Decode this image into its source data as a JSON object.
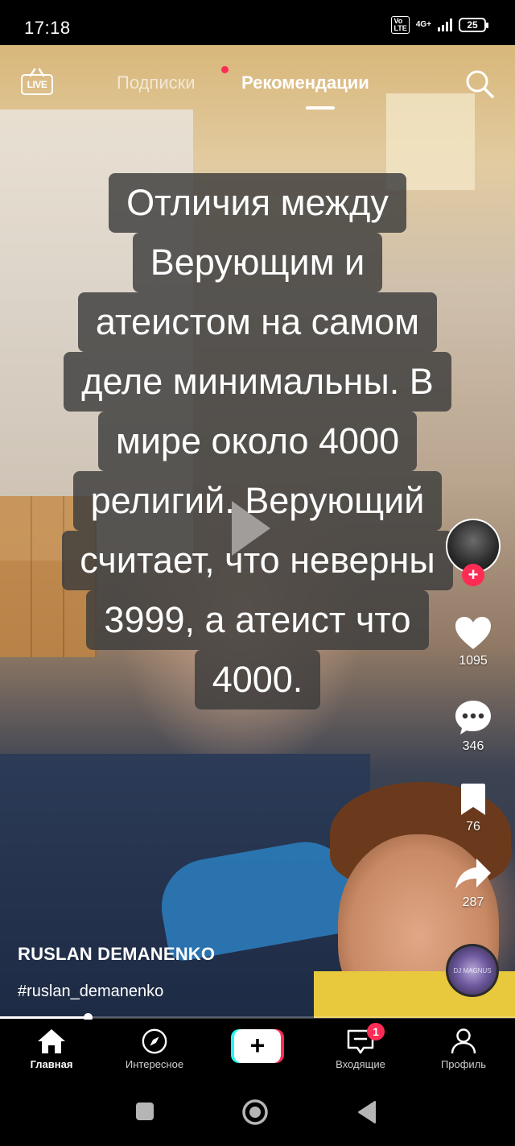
{
  "status_bar": {
    "time": "17:18",
    "volte_label": "Vo LTE",
    "network_label": "4G+",
    "battery_level": "25"
  },
  "top_nav": {
    "live_label": "LIVE",
    "tabs": [
      {
        "label": "Подписки",
        "active": false,
        "has_dot": true
      },
      {
        "label": "Рекомендации",
        "active": true
      }
    ],
    "search_icon": "search-icon"
  },
  "caption": {
    "lines": [
      "Отличия между",
      "Верующим и",
      "атеистом на самом",
      "деле минимальны. В",
      "мире около 4000",
      "религий. Верующий",
      "считает, что неверны",
      "3999, а атеист что",
      "4000."
    ]
  },
  "rail": {
    "likes": "1095",
    "comments": "346",
    "saves": "76",
    "shares": "287",
    "disc_text": "DJ MAGNUS"
  },
  "author": {
    "name": "RUSLAN DEMANENKO",
    "hashtag": "#ruslan_demanenko"
  },
  "progress": {
    "fraction": 0.17
  },
  "bottom_nav": {
    "items": [
      {
        "label": "Главная",
        "icon": "home-icon",
        "active": true
      },
      {
        "label": "Интересное",
        "icon": "compass-icon",
        "active": false
      },
      {
        "label": "",
        "icon": "create-plus-icon",
        "active": false
      },
      {
        "label": "Входящие",
        "icon": "inbox-icon",
        "active": false,
        "badge": "1"
      },
      {
        "label": "Профиль",
        "icon": "profile-icon",
        "active": false
      }
    ]
  },
  "colors": {
    "accent_red": "#fe2c55",
    "accent_cyan": "#25f4ee",
    "background": "#000000"
  }
}
